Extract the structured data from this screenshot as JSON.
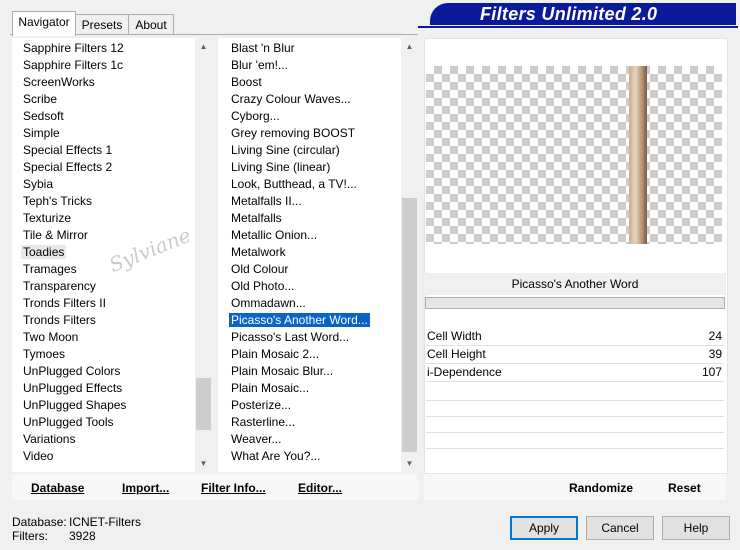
{
  "tabs": [
    {
      "label": "Navigator",
      "active": true
    },
    {
      "label": "Presets",
      "active": false
    },
    {
      "label": "About",
      "active": false
    }
  ],
  "banner": {
    "title": "Filters Unlimited 2.0",
    "color": "#0a1a9a"
  },
  "categories": {
    "items": [
      "Sapphire Filters 12",
      "Sapphire Filters 1c",
      "ScreenWorks",
      "Scribe",
      "Sedsoft",
      "Simple",
      "Special Effects 1",
      "Special Effects 2",
      "Sybia",
      "Teph's Tricks",
      "Texturize",
      "Tile & Mirror",
      "Toadies",
      "Tramages",
      "Transparency",
      "Tronds Filters II",
      "Tronds Filters",
      "Two Moon",
      "Tymoes",
      "UnPlugged Colors",
      "UnPlugged Effects",
      "UnPlugged Shapes",
      "UnPlugged Tools",
      "Variations",
      "Video"
    ],
    "selected": "Toadies"
  },
  "filters": {
    "items": [
      "Blast 'n Blur",
      "Blur 'em!...",
      "Boost",
      "Crazy Colour Waves...",
      "Cyborg...",
      "Grey removing BOOST",
      "Living Sine (circular)",
      "Living Sine (linear)",
      "Look, Butthead, a TV!...",
      "Metalfalls II...",
      "Metalfalls",
      "Metallic Onion...",
      "Metalwork",
      "Old Colour",
      "Old Photo...",
      "Ommadawn...",
      "Picasso's Another Word...",
      "Picasso's Last Word...",
      "Plain Mosaic 2...",
      "Plain Mosaic Blur...",
      "Plain Mosaic...",
      "Posterize...",
      "Rasterline...",
      "Weaver...",
      "What Are You?..."
    ],
    "selected": "Picasso's Another Word..."
  },
  "watermark": "Sylviane",
  "filter_title": "Picasso's Another Word",
  "params": [
    {
      "label": "Cell Width",
      "value": "24"
    },
    {
      "label": "Cell Height",
      "value": "39"
    },
    {
      "label": "i-Dependence",
      "value": "107"
    }
  ],
  "toolbar": {
    "database": "Database",
    "import": "Import...",
    "filter_info": "Filter Info...",
    "editor": "Editor...",
    "randomize": "Randomize",
    "reset": "Reset"
  },
  "status": {
    "database_label": "Database:",
    "database_value": "ICNET-Filters",
    "filters_label": "Filters:",
    "filters_value": "3928"
  },
  "dialog": {
    "apply": "Apply",
    "cancel": "Cancel",
    "help": "Help"
  },
  "icons": {
    "scroll_up": "chevron-up-icon",
    "scroll_down": "chevron-down-icon"
  }
}
